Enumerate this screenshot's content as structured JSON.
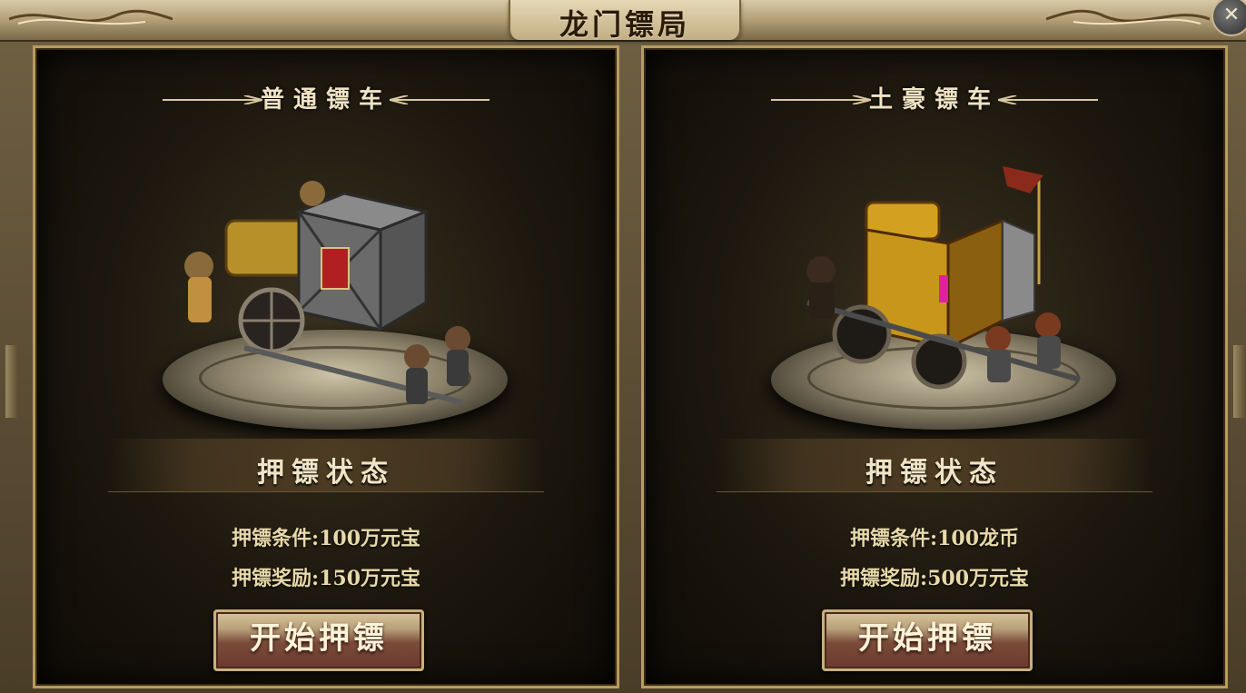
{
  "window": {
    "title": "龙门镖局",
    "close_label": "✕"
  },
  "carts": [
    {
      "name": "普通镖车",
      "status_label": "押镖状态",
      "condition": "押镖条件:100万元宝",
      "reward": "押镖奖励:150万元宝",
      "start_label": "开始押镖",
      "accent": "#d4b060"
    },
    {
      "name": "土豪镖车",
      "status_label": "押镖状态",
      "condition": "押镖条件:100龙币",
      "reward": "押镖奖励:500万元宝",
      "start_label": "开始押镖",
      "accent": "#e0b020"
    }
  ]
}
